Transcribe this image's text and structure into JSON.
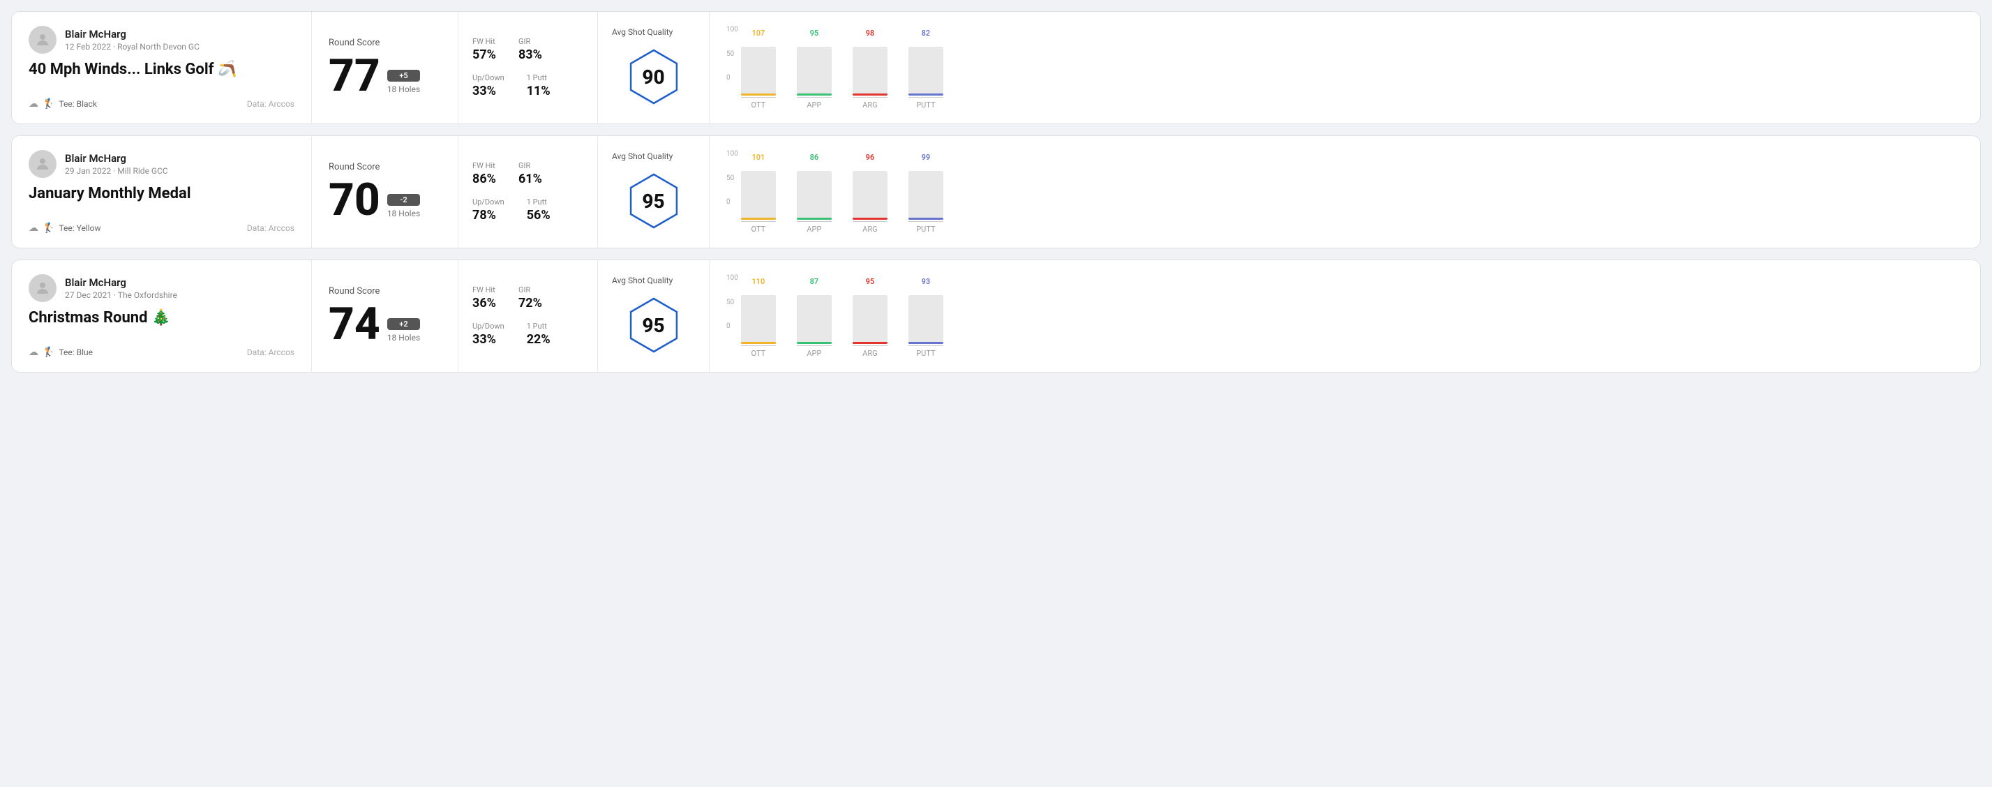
{
  "rounds": [
    {
      "id": "round1",
      "user": {
        "name": "Blair McHarg",
        "date": "12 Feb 2022 · Royal North Devon GC"
      },
      "title": "40 Mph Winds... Links Golf",
      "title_emoji": "🪃",
      "tee": "Black",
      "data_source": "Data: Arccos",
      "score": {
        "label": "Round Score",
        "value": "77",
        "modifier": "+5",
        "holes": "18 Holes"
      },
      "stats": {
        "fw_hit_label": "FW Hit",
        "fw_hit_value": "57%",
        "gir_label": "GIR",
        "gir_value": "83%",
        "updown_label": "Up/Down",
        "updown_value": "33%",
        "oneputt_label": "1 Putt",
        "oneputt_value": "11%"
      },
      "quality": {
        "label": "Avg Shot Quality",
        "score": "90"
      },
      "chart": {
        "columns": [
          {
            "label": "OTT",
            "value": 107,
            "color": "#f0b429"
          },
          {
            "label": "APP",
            "value": 95,
            "color": "#38c172"
          },
          {
            "label": "ARG",
            "value": 98,
            "color": "#e3342f"
          },
          {
            "label": "PUTT",
            "value": 82,
            "color": "#6574cd"
          }
        ],
        "y_max": 100,
        "y_labels": [
          "100",
          "50",
          "0"
        ]
      }
    },
    {
      "id": "round2",
      "user": {
        "name": "Blair McHarg",
        "date": "29 Jan 2022 · Mill Ride GCC"
      },
      "title": "January Monthly Medal",
      "title_emoji": "",
      "tee": "Yellow",
      "data_source": "Data: Arccos",
      "score": {
        "label": "Round Score",
        "value": "70",
        "modifier": "-2",
        "holes": "18 Holes"
      },
      "stats": {
        "fw_hit_label": "FW Hit",
        "fw_hit_value": "86%",
        "gir_label": "GIR",
        "gir_value": "61%",
        "updown_label": "Up/Down",
        "updown_value": "78%",
        "oneputt_label": "1 Putt",
        "oneputt_value": "56%"
      },
      "quality": {
        "label": "Avg Shot Quality",
        "score": "95"
      },
      "chart": {
        "columns": [
          {
            "label": "OTT",
            "value": 101,
            "color": "#f0b429"
          },
          {
            "label": "APP",
            "value": 86,
            "color": "#38c172"
          },
          {
            "label": "ARG",
            "value": 96,
            "color": "#e3342f"
          },
          {
            "label": "PUTT",
            "value": 99,
            "color": "#6574cd"
          }
        ],
        "y_max": 100,
        "y_labels": [
          "100",
          "50",
          "0"
        ]
      }
    },
    {
      "id": "round3",
      "user": {
        "name": "Blair McHarg",
        "date": "27 Dec 2021 · The Oxfordshire"
      },
      "title": "Christmas Round",
      "title_emoji": "🎄",
      "tee": "Blue",
      "data_source": "Data: Arccos",
      "score": {
        "label": "Round Score",
        "value": "74",
        "modifier": "+2",
        "holes": "18 Holes"
      },
      "stats": {
        "fw_hit_label": "FW Hit",
        "fw_hit_value": "36%",
        "gir_label": "GIR",
        "gir_value": "72%",
        "updown_label": "Up/Down",
        "updown_value": "33%",
        "oneputt_label": "1 Putt",
        "oneputt_value": "22%"
      },
      "quality": {
        "label": "Avg Shot Quality",
        "score": "95"
      },
      "chart": {
        "columns": [
          {
            "label": "OTT",
            "value": 110,
            "color": "#f0b429"
          },
          {
            "label": "APP",
            "value": 87,
            "color": "#38c172"
          },
          {
            "label": "ARG",
            "value": 95,
            "color": "#e3342f"
          },
          {
            "label": "PUTT",
            "value": 93,
            "color": "#6574cd"
          }
        ],
        "y_max": 100,
        "y_labels": [
          "100",
          "50",
          "0"
        ]
      }
    }
  ]
}
